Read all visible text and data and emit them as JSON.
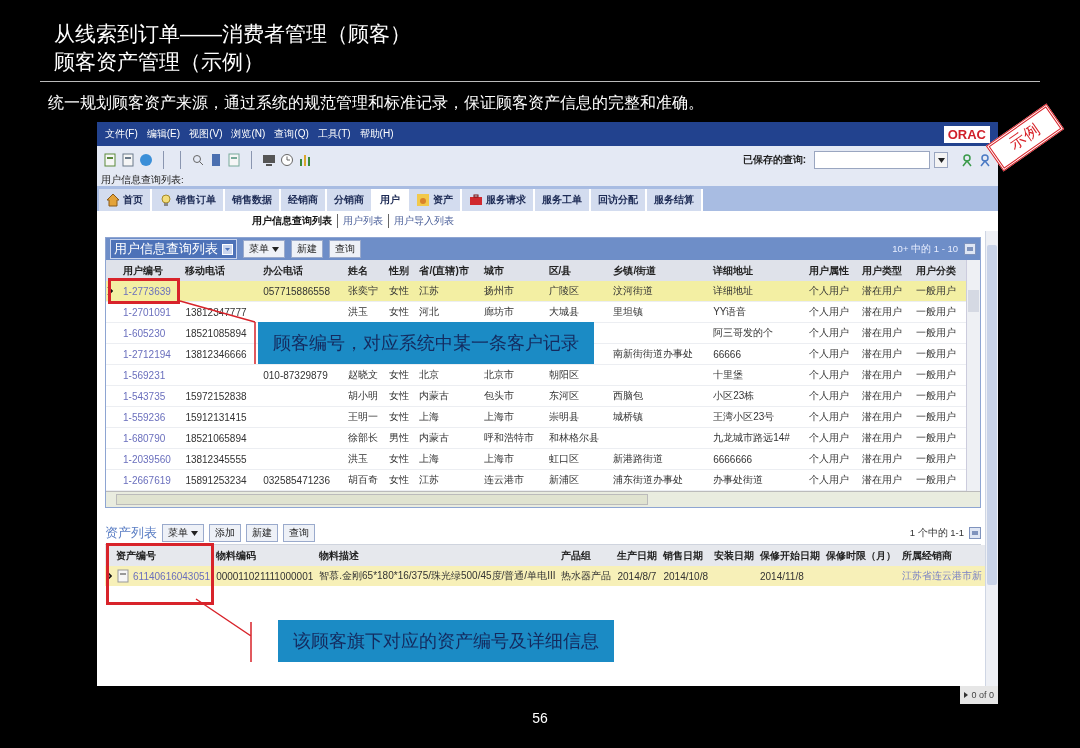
{
  "slide": {
    "title_lines": [
      "从线索到订单——消费者管理（顾客）",
      "顾客资产管理（示例）"
    ],
    "subtitle": "统一规划顾客资产来源，通过系统的规范管理和标准记录，保证顾客资产信息的完整和准确。",
    "stamp": "示例",
    "page_number": "56"
  },
  "app": {
    "logo": "ORAC",
    "menu": [
      "文件(F)",
      "编辑(E)",
      "视图(V)",
      "浏览(N)",
      "查询(Q)",
      "工具(T)",
      "帮助(H)"
    ],
    "saved_query_label": "已保存的查询:",
    "view_label": "用户信息查询列表:",
    "tabs": [
      {
        "label": "首页",
        "kind": "home",
        "selected": false
      },
      {
        "label": "销售订单",
        "kind": "bulb",
        "selected": false
      },
      {
        "label": "销售数据",
        "kind": "plain",
        "selected": false
      },
      {
        "label": "经销商",
        "kind": "plain",
        "selected": false
      },
      {
        "label": "分销商",
        "kind": "plain",
        "selected": false
      },
      {
        "label": "用户",
        "kind": "plain",
        "selected": true
      },
      {
        "label": "资产",
        "kind": "asset",
        "selected": false
      },
      {
        "label": "服务请求",
        "kind": "case",
        "selected": false
      },
      {
        "label": "服务工单",
        "kind": "plain",
        "selected": false
      },
      {
        "label": "回访分配",
        "kind": "plain",
        "selected": false
      },
      {
        "label": "服务结算",
        "kind": "plain",
        "selected": false
      }
    ],
    "sub_links": [
      {
        "label": "用户信息查询列表",
        "selected": true
      },
      {
        "label": "用户列表",
        "selected": false
      },
      {
        "label": "用户导入列表",
        "selected": false
      }
    ],
    "user_list": {
      "title": "用户信息查询列表",
      "menu_button": "菜单",
      "buttons": [
        "新建",
        "查询"
      ],
      "count": "10+ 中的 1 - 10",
      "columns": [
        "用户编号",
        "移动电话",
        "办公电话",
        "姓名",
        "性别",
        "省/(直辖)市",
        "城市",
        "区/县",
        "乡镇/街道",
        "详细地址",
        "用户属性",
        "用户类型",
        "用户分类"
      ],
      "rows": [
        {
          "selected": true,
          "cells": [
            "1-2773639",
            null,
            "057715886558",
            "张奕宁",
            "女性",
            "江苏",
            "扬州市",
            "广陵区",
            "汶河街道",
            "详细地址",
            "个人用户",
            "潜在用户",
            "一般用户"
          ]
        },
        {
          "selected": false,
          "cells": [
            "1-2701091",
            "13812347777",
            null,
            "洪玉",
            "女性",
            "河北",
            "廊坊市",
            "大城县",
            "里坦镇",
            "YY语音",
            "个人用户",
            "潜在用户",
            "一般用户"
          ]
        },
        {
          "selected": false,
          "cells": [
            "1-605230",
            "18521085894",
            null,
            null,
            null,
            null,
            null,
            null,
            null,
            "阿三哥发的个",
            "个人用户",
            "潜在用户",
            "一般用户"
          ]
        },
        {
          "selected": false,
          "cells": [
            "1-2712194",
            "13812346666",
            null,
            null,
            null,
            null,
            null,
            null,
            "南新街街道办事处",
            "66666",
            "个人用户",
            "潜在用户",
            "一般用户"
          ]
        },
        {
          "selected": false,
          "cells": [
            "1-569231",
            null,
            "010-87329879",
            "赵晓文",
            "女性",
            "北京",
            "北京市",
            "朝阳区",
            null,
            "十里堡",
            "个人用户",
            "潜在用户",
            "一般用户"
          ]
        },
        {
          "selected": false,
          "cells": [
            "1-543735",
            "15972152838",
            null,
            "胡小明",
            "女性",
            "内蒙古",
            "包头市",
            "东河区",
            "西脑包",
            "小区23栋",
            "个人用户",
            "潜在用户",
            "一般用户"
          ]
        },
        {
          "selected": false,
          "cells": [
            "1-559236",
            "15912131415",
            null,
            "王明一",
            "女性",
            "上海",
            "上海市",
            "崇明县",
            "城桥镇",
            "王湾小区23号",
            "个人用户",
            "潜在用户",
            "一般用户"
          ]
        },
        {
          "selected": false,
          "cells": [
            "1-680790",
            "18521065894",
            null,
            "徐部长",
            "男性",
            "内蒙古",
            "呼和浩特市",
            "和林格尔县",
            null,
            "九龙城市路远14#",
            "个人用户",
            "潜在用户",
            "一般用户"
          ]
        },
        {
          "selected": false,
          "cells": [
            "1-2039560",
            "13812345555",
            null,
            "洪玉",
            "女性",
            "上海",
            "上海市",
            "虹口区",
            "新港路街道",
            "6666666",
            "个人用户",
            "潜在用户",
            "一般用户"
          ]
        },
        {
          "selected": false,
          "cells": [
            "1-2667619",
            "15891253234",
            "032585471236",
            "胡百奇",
            "女性",
            "江苏",
            "连云港市",
            "新浦区",
            "浦东街道办事处",
            "办事处街道",
            "个人用户",
            "潜在用户",
            "一般用户"
          ]
        }
      ]
    },
    "asset_list": {
      "title": "资产列表",
      "menu_button": "菜单",
      "buttons": [
        "添加",
        "新建",
        "查询"
      ],
      "count": "1 个中的 1-1",
      "columns": [
        "资产编号",
        "物料编码",
        "物料描述",
        "产品组",
        "生产日期",
        "销售日期",
        "安装日期",
        "保修开始日期",
        "保修时限（月）",
        "所属经销商"
      ],
      "rows": [
        {
          "selected": true,
          "cells": [
            "61140616043051",
            "000011021111000001",
            "智慕.金刚65*180*16/375/珠光绿500/45度/普通/单电III",
            "热水器产品",
            "2014/8/7",
            "2014/10/8",
            null,
            "2014/11/8",
            null,
            "江苏省连云港市新"
          ]
        }
      ]
    },
    "pager": "0 of 0"
  },
  "callouts": [
    {
      "text": "顾客编号，对应系统中某一条客户记录"
    },
    {
      "text": "该顾客旗下对应的资产编号及详细信息"
    }
  ]
}
